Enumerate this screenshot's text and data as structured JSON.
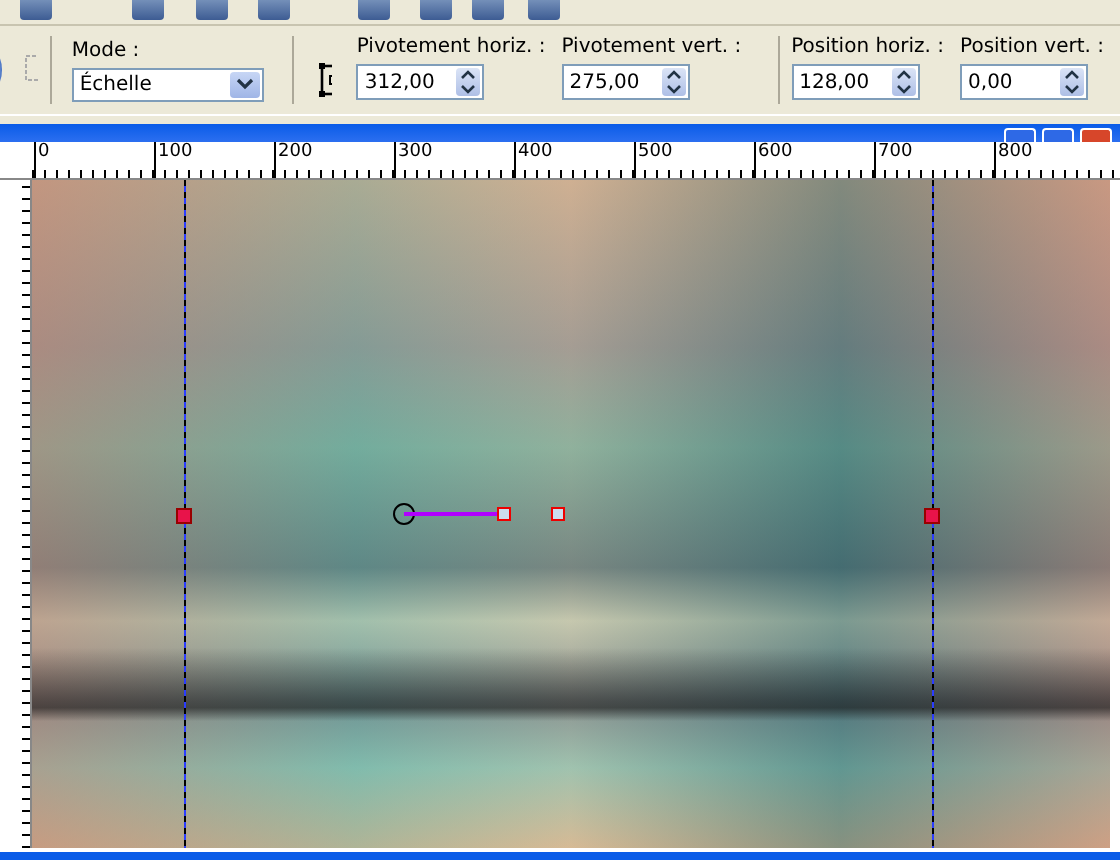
{
  "tool_options": {
    "mode": {
      "label": "Mode :",
      "value": "Échelle"
    },
    "fields": [
      {
        "label": "Pivotement horiz. :",
        "value": "312,00"
      },
      {
        "label": "Pivotement vert. :",
        "value": "275,00"
      },
      {
        "label": "Position horiz. :",
        "value": "128,00"
      },
      {
        "label": "Position vert. :",
        "value": "0,00"
      }
    ]
  },
  "ruler": {
    "labels": [
      "0",
      "100",
      "200",
      "300",
      "400",
      "500",
      "600",
      "700",
      "800"
    ]
  }
}
